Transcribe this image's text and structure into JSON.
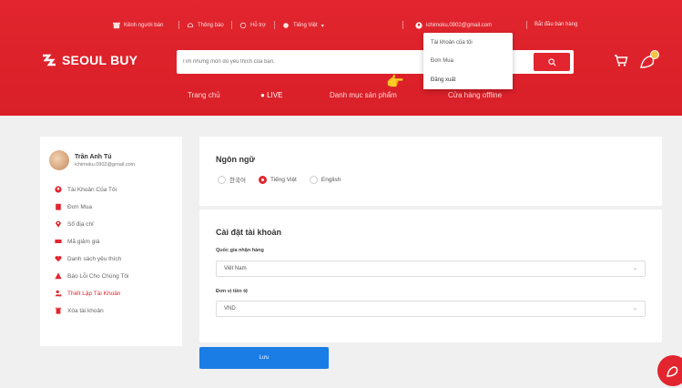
{
  "topbar": {
    "seller_channel": "Kênh người bán",
    "notifications": "Thông báo",
    "help": "Hỗ trợ",
    "language": "Tiếng Việt",
    "email": "ichimoku.0902@gmail.com",
    "start_selling": "Bắt đầu bán hàng"
  },
  "logo_text": "SEOUL BUY",
  "search": {
    "placeholder": "Tìm những món đồ yêu thích của bạn."
  },
  "nav": {
    "home": "Trang chủ",
    "live": "LIVE",
    "categories": "Danh mục sản phẩm",
    "offline_store": "Cửa hàng offline"
  },
  "dropdown": {
    "my_account": "Tài khoản của tôi",
    "orders": "Đơn Mua",
    "logout": "Đăng xuất"
  },
  "user": {
    "name": "Trần Anh Tú",
    "email": "ichimoku.0902@gmail.com"
  },
  "sidebar": {
    "items": [
      {
        "label": "Tài Khoản Của Tôi",
        "icon": "user-circle-icon",
        "color": "#e2252e"
      },
      {
        "label": "Đơn Mua",
        "icon": "clipboard-icon",
        "color": "#e2252e"
      },
      {
        "label": "Sổ địa chỉ",
        "icon": "location-pin-icon",
        "color": "#e2252e"
      },
      {
        "label": "Mã giảm giá",
        "icon": "ticket-icon",
        "color": "#e2252e"
      },
      {
        "label": "Danh sách yêu thích",
        "icon": "heart-icon",
        "color": "#e2252e"
      },
      {
        "label": "Báo Lỗi Cho Chúng Tôi",
        "icon": "warning-icon",
        "color": "#e2252e"
      },
      {
        "label": "Thiết Lập Tài Khoản",
        "icon": "user-settings-icon",
        "color": "#e2252e",
        "active": true
      },
      {
        "label": "Xóa tài khoản",
        "icon": "trash-icon",
        "color": "#e2252e"
      }
    ]
  },
  "language_panel": {
    "title": "Ngôn ngữ",
    "options": [
      "한국어",
      "Tiếng Việt",
      "English"
    ],
    "selected": "Tiếng Việt"
  },
  "account_panel": {
    "title": "Cài đặt tài khoản",
    "country_label": "Quốc gia nhận hàng",
    "country_value": "Việt Nam",
    "currency_label": "Đơn vị tiền tệ",
    "currency_value": "VND"
  },
  "save_label": "Lưu",
  "colors": {
    "brand": "#e2252e",
    "save": "#1a7de6"
  }
}
